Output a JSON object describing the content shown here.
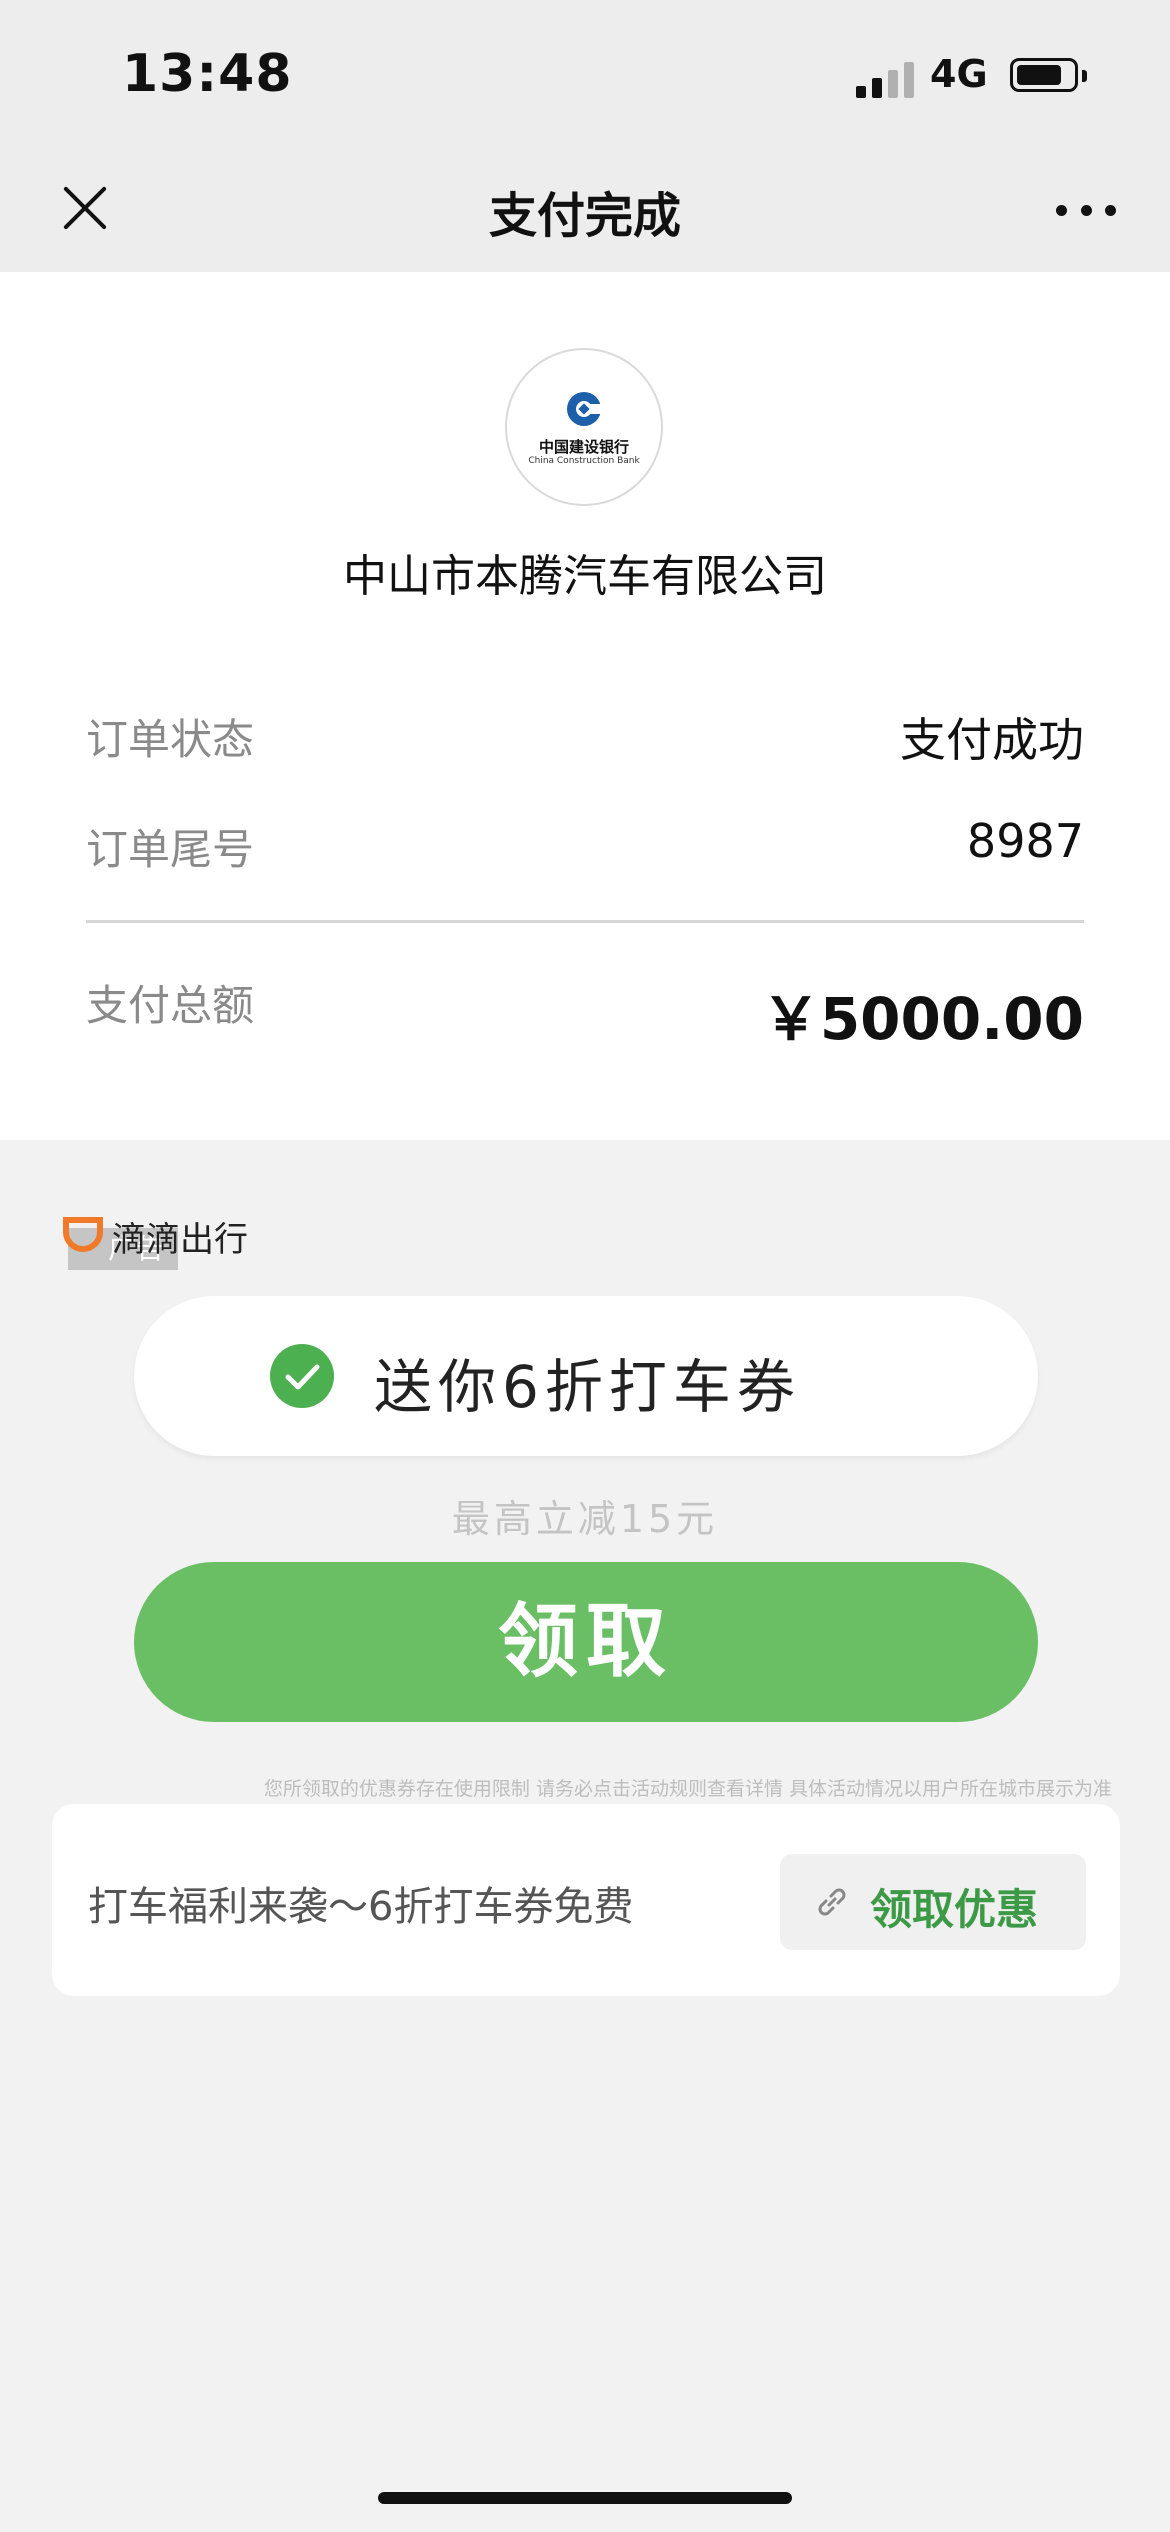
{
  "status_bar": {
    "time": "13:48",
    "network": "4G"
  },
  "nav": {
    "title": "支付完成"
  },
  "bank": {
    "name_cn": "中国建设银行",
    "name_en": "China Construction Bank"
  },
  "merchant": "中山市本腾汽车有限公司",
  "order": {
    "status_label": "订单状态",
    "status_value": "支付成功",
    "tail_label": "订单尾号",
    "tail_value": "8987",
    "total_label": "支付总额",
    "total_value": "￥5000.00"
  },
  "ad": {
    "brand": "滴滴出行",
    "tag": "广告",
    "coupon_title": "送你6折打车券",
    "coupon_subtitle": "最高立减15元",
    "claim_button": "领取",
    "disclaimer": "您所领取的优惠券存在使用限制 请务必点击活动规则查看详情 具体活动情况以用户所在城市展示为准"
  },
  "promo": {
    "text": "打车福利来袭～6折打车券免费",
    "button": "领取优惠"
  },
  "colors": {
    "accent_green": "#6abf64",
    "check_green": "#4caf50",
    "link_green": "#3c9a46",
    "bank_blue": "#1d5fa8",
    "didi_orange": "#f07a2a"
  }
}
